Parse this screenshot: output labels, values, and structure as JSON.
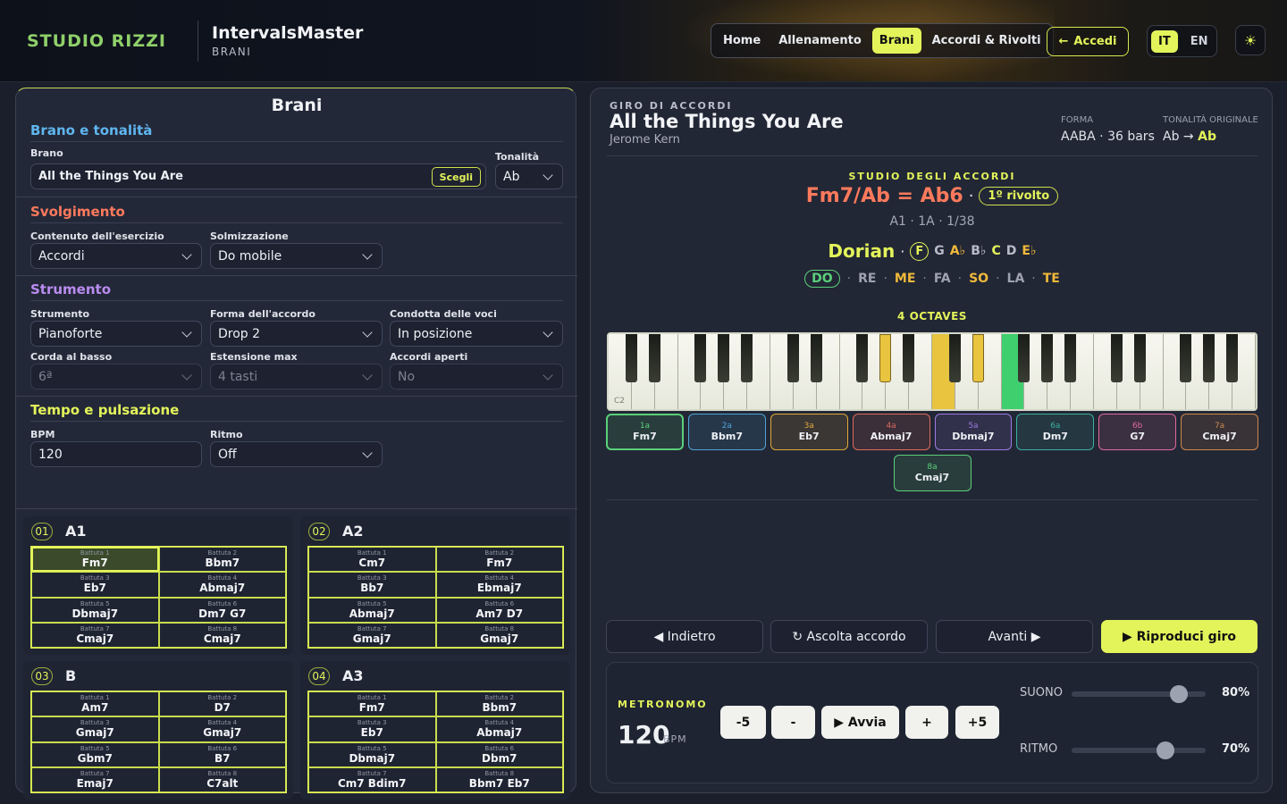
{
  "header": {
    "logo_text": "STUDIO RIZZI",
    "app_title": "IntervalsMaster",
    "app_subtitle": "BRANI",
    "nav": [
      "Home",
      "Allenamento",
      "Brani",
      "Accordi & Rivolti"
    ],
    "nav_active": "Brani",
    "login_label": "Accedi",
    "langs": [
      "IT",
      "EN"
    ],
    "lang_active": "IT",
    "theme_icon": "sun-icon",
    "accent_color": "#e3f45a"
  },
  "left": {
    "title": "Brani",
    "brano_section": {
      "title": "Brano e tonalità",
      "brano_label": "Brano",
      "brano_value": "All the Things You Are",
      "choose_label": "Scegli",
      "key_label": "Tonalità",
      "key_value": "Ab"
    },
    "svolgimento": {
      "title": "Svolgimento",
      "content_label": "Contenuto dell'esercizio",
      "content_value": "Accordi",
      "solm_label": "Solmizzazione",
      "solm_value": "Do mobile"
    },
    "strumento": {
      "title": "Strumento",
      "instr_label": "Strumento",
      "instr_value": "Pianoforte",
      "shape_label": "Forma dell'accordo",
      "shape_value": "Drop 2",
      "voice_label": "Condotta delle voci",
      "voice_value": "In posizione",
      "bass_label": "Corda al basso",
      "bass_value": "6ª",
      "ext_label": "Estensione max",
      "ext_value": "4 tasti",
      "open_label": "Accordi aperti",
      "open_value": "No"
    },
    "tempo": {
      "title": "Tempo e pulsazione",
      "bpm_label": "BPM",
      "bpm_value": "120",
      "rhythm_label": "Ritmo",
      "rhythm_value": "Off"
    },
    "blocks": [
      {
        "num": "01",
        "name": "A1",
        "bars": [
          {
            "label": "Battuta 1",
            "chord": "Fm7"
          },
          {
            "label": "Battuta 2",
            "chord": "Bbm7"
          },
          {
            "label": "Battuta 3",
            "chord": "Eb7"
          },
          {
            "label": "Battuta 4",
            "chord": "Abmaj7"
          },
          {
            "label": "Battuta 5",
            "chord": "Dbmaj7"
          },
          {
            "label": "Battuta 6",
            "chord": "Dm7 G7"
          },
          {
            "label": "Battuta 7",
            "chord": "Cmaj7"
          },
          {
            "label": "Battuta 8",
            "chord": "Cmaj7"
          }
        ]
      },
      {
        "num": "02",
        "name": "A2",
        "bars": [
          {
            "label": "Battuta 1",
            "chord": "Cm7"
          },
          {
            "label": "Battuta 2",
            "chord": "Fm7"
          },
          {
            "label": "Battuta 3",
            "chord": "Bb7"
          },
          {
            "label": "Battuta 4",
            "chord": "Ebmaj7"
          },
          {
            "label": "Battuta 5",
            "chord": "Abmaj7"
          },
          {
            "label": "Battuta 6",
            "chord": "Am7 D7"
          },
          {
            "label": "Battuta 7",
            "chord": "Gmaj7"
          },
          {
            "label": "Battuta 8",
            "chord": "Gmaj7"
          }
        ]
      },
      {
        "num": "03",
        "name": "B",
        "bars": [
          {
            "label": "Battuta 1",
            "chord": "Am7"
          },
          {
            "label": "Battuta 2",
            "chord": "D7"
          },
          {
            "label": "Battuta 3",
            "chord": "Gmaj7"
          },
          {
            "label": "Battuta 4",
            "chord": "Gmaj7"
          },
          {
            "label": "Battuta 5",
            "chord": "Gbm7"
          },
          {
            "label": "Battuta 6",
            "chord": "B7"
          },
          {
            "label": "Battuta 7",
            "chord": "Emaj7"
          },
          {
            "label": "Battuta 8",
            "chord": "C7alt"
          }
        ]
      },
      {
        "num": "04",
        "name": "A3",
        "bars": [
          {
            "label": "Battuta 1",
            "chord": "Fm7"
          },
          {
            "label": "Battuta 2",
            "chord": "Bbm7"
          },
          {
            "label": "Battuta 3",
            "chord": "Eb7"
          },
          {
            "label": "Battuta 4",
            "chord": "Abmaj7"
          },
          {
            "label": "Battuta 5",
            "chord": "Dbmaj7"
          },
          {
            "label": "Battuta 6",
            "chord": "Dbm7"
          },
          {
            "label": "Battuta 7",
            "chord": "Cm7 Bdim7"
          },
          {
            "label": "Battuta 8",
            "chord": "Bbm7 Eb7"
          }
        ]
      }
    ]
  },
  "right": {
    "eyebrow": "GIRO DI ACCORDI",
    "song_title": "All the Things You Are",
    "composer": "Jerome Kern",
    "form_label": "FORMA",
    "form_value": "AABA · 36 bars",
    "orig_key_label": "TONALITÀ ORIGINALE",
    "orig_key_from": "Ab",
    "orig_key_to": "Ab",
    "study_eyebrow": "STUDIO DEGLI ACCORDI",
    "chord_name": "Fm7/Ab = Ab6",
    "inversion": "1º rivolto",
    "position": "A1 · 1A · 1/38",
    "mode_name": "Dorian",
    "mode_notes": [
      {
        "n": "F",
        "color": "#e3f45a",
        "circle": true
      },
      {
        "n": "G",
        "color": "#b7bcc8"
      },
      {
        "n": "A♭",
        "color": "#f0b93a"
      },
      {
        "n": "B♭",
        "color": "#b7bcc8"
      },
      {
        "n": "C",
        "color": "#e3f45a"
      },
      {
        "n": "D",
        "color": "#b7bcc8"
      },
      {
        "n": "E♭",
        "color": "#f0b93a"
      }
    ],
    "solfege": [
      {
        "s": "DO",
        "color": "#5ad07a",
        "pill": true
      },
      {
        "s": "RE",
        "color": "#9ea3b0"
      },
      {
        "s": "ME",
        "color": "#f0b93a"
      },
      {
        "s": "FA",
        "color": "#9ea3b0"
      },
      {
        "s": "SO",
        "color": "#f0b93a"
      },
      {
        "s": "LA",
        "color": "#9ea3b0"
      },
      {
        "s": "TE",
        "color": "#f0b93a"
      }
    ],
    "octaves_label": "4 OCTAVES",
    "keyboard_start": "C2",
    "degrees": [
      {
        "n": "1a",
        "c": "Fm7",
        "color": "#5ad07a"
      },
      {
        "n": "2a",
        "c": "Bbm7",
        "color": "#4ea4d8"
      },
      {
        "n": "3a",
        "c": "Eb7",
        "color": "#e0a83a"
      },
      {
        "n": "4a",
        "c": "Abmaj7",
        "color": "#e06a5a"
      },
      {
        "n": "5a",
        "c": "Dbmaj7",
        "color": "#9b7ae0"
      },
      {
        "n": "6a",
        "c": "Dm7",
        "color": "#3ab0a0"
      },
      {
        "n": "6b",
        "c": "G7",
        "color": "#e06aa0"
      },
      {
        "n": "7a",
        "c": "Cmaj7",
        "color": "#d0884a"
      },
      {
        "n": "8a",
        "c": "Cmaj7",
        "color": "#5ad07a"
      }
    ],
    "controls": {
      "back": "◀ Indietro",
      "listen": "↻ Ascolta accordo",
      "next": "Avanti ▶",
      "play": "▶ Riproduci giro"
    },
    "metronome": {
      "title": "METRONOMO",
      "bpm": "120",
      "bpm_unit": "BPM",
      "buttons": [
        "-5",
        "-",
        "▶ Avvia",
        "+",
        "+5"
      ],
      "sound_label": "SUONO",
      "sound_value": "80%",
      "sound_level": 0.8,
      "rhythm_label": "RITMO",
      "rhythm_value": "70%",
      "rhythm_level": 0.7
    }
  }
}
